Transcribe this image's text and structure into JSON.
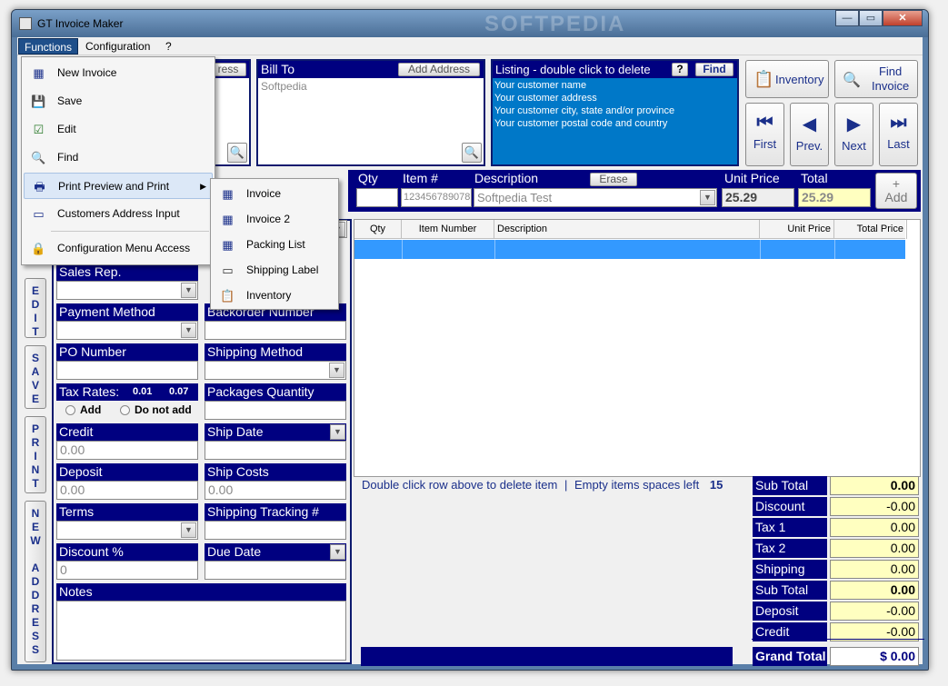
{
  "window": {
    "title": "GT Invoice Maker",
    "watermark": "SOFTPEDIA",
    "minimize": "—",
    "maximize": "▭",
    "close": "✕"
  },
  "menubar": {
    "functions": "Functions",
    "configuration": "Configuration",
    "help": "?"
  },
  "functions_menu": {
    "items": [
      "New Invoice",
      "Save",
      "Edit",
      "Find",
      "Print Preview and Print",
      "Customers Address Input",
      "Configuration Menu Access"
    ]
  },
  "print_submenu": {
    "items": [
      "Invoice",
      "Invoice 2",
      "Packing List",
      "Shipping Label",
      "Inventory"
    ]
  },
  "ship_to": {
    "add_address_fragment": "ress"
  },
  "bill_to": {
    "title": "Bill To",
    "add_address": "Add Address",
    "value": "Softpedia"
  },
  "listing": {
    "title": "Listing - double click to delete",
    "help": "?",
    "find": "Find",
    "lines": [
      "Your customer name",
      "Your customer address",
      "Your customer city, state and/or province",
      "Your customer postal code and country"
    ]
  },
  "nav": {
    "inventory": "Inventory",
    "find_invoice_1": "Find",
    "find_invoice_2": "Invoice",
    "first": "First",
    "prev": "Prev.",
    "next": "Next",
    "last": "Last"
  },
  "item_entry": {
    "qty_label": "Qty",
    "item_label": "Item #",
    "desc_label": "Description",
    "erase": "Erase",
    "unit_price_label": "Unit Price",
    "total_label": "Total",
    "item_value": "123456789078",
    "desc_value": "Softpedia Test",
    "unit_price_value": "25.29",
    "total_value": "25.29",
    "add": "Add",
    "add_plus": "+"
  },
  "table": {
    "headers": [
      "Qty",
      "Item Number",
      "Description",
      "Unit Price",
      "Total Price"
    ]
  },
  "side_buttons": {
    "edit": "EDIT",
    "save": "SAVE",
    "print": "PRINT",
    "new_address": "NEW ADDRESS"
  },
  "fields": {
    "sales_rep": "Sales Rep.",
    "payment_method": "Payment Method",
    "backorder_number": "Backorder Number",
    "po_number": "PO Number",
    "shipping_method": "Shipping Method",
    "tax_rates": "Tax Rates:",
    "tax1": "0.01",
    "tax2": "0.07",
    "add": "Add",
    "do_not_add": "Do not add",
    "packages_quantity": "Packages Quantity",
    "credit": "Credit",
    "credit_value": "0.00",
    "ship_date": "Ship Date",
    "deposit": "Deposit",
    "deposit_value": "0.00",
    "ship_costs": "Ship Costs",
    "ship_costs_value": "0.00",
    "terms": "Terms",
    "shipping_tracking": "Shipping Tracking  #",
    "discount_pct": "Discount %",
    "discount_value": "0",
    "due_date": "Due Date",
    "notes": "Notes"
  },
  "status": {
    "hint": "Double click row above to delete item",
    "sep": "|",
    "empty_label": "Empty items spaces left",
    "empty_count": "15"
  },
  "totals": [
    {
      "label": "Sub Total",
      "value": "0.00",
      "bold": true
    },
    {
      "label": "Discount",
      "value": "-0.00",
      "bold": false
    },
    {
      "label": "Tax 1",
      "value": "0.00",
      "bold": false
    },
    {
      "label": "Tax 2",
      "value": "0.00",
      "bold": false
    },
    {
      "label": "Shipping",
      "value": "0.00",
      "bold": false
    },
    {
      "label": "Sub Total",
      "value": "0.00",
      "bold": true
    },
    {
      "label": "Deposit",
      "value": "-0.00",
      "bold": false
    },
    {
      "label": "Credit",
      "value": "-0.00",
      "bold": false
    }
  ],
  "grand_total": {
    "label": "Grand Total",
    "value": "$ 0.00"
  },
  "colors": {
    "navy": "#000080",
    "selection": "#3399ff",
    "listing_bg": "#0078c8",
    "total_bg": "#ffffc0"
  }
}
